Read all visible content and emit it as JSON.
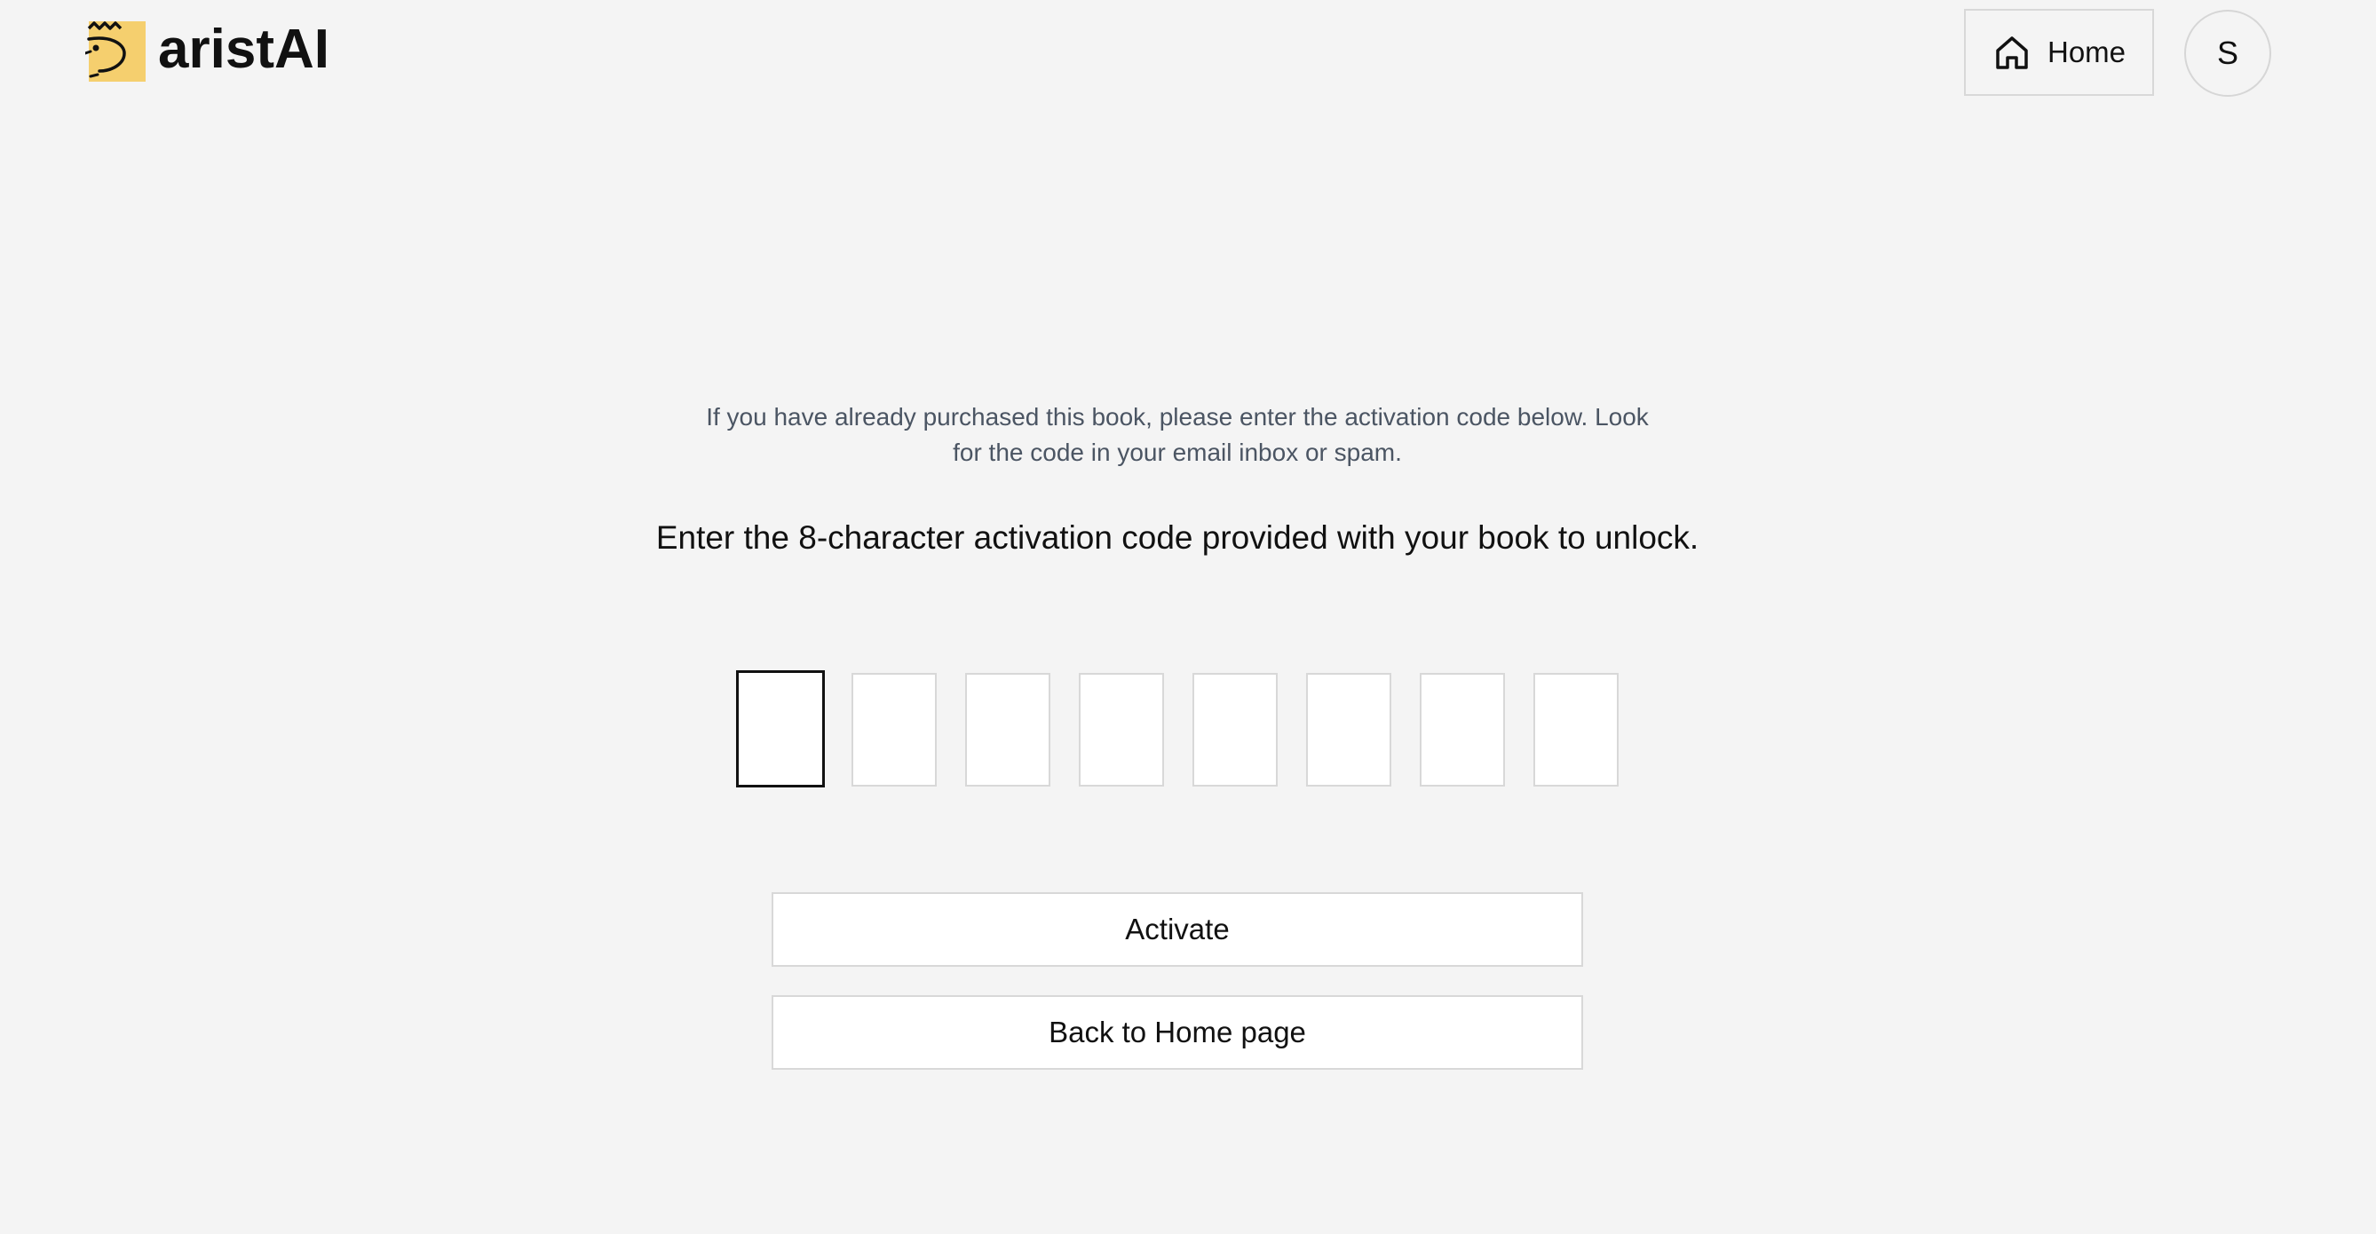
{
  "header": {
    "logo_text": "aristAI",
    "home_button_label": "Home",
    "avatar_initial": "S"
  },
  "main": {
    "info_text": "If you have already purchased this book, please enter the activation code below. Look for the code in your email inbox or spam.",
    "instruction": "Enter the 8-character activation code provided with your book to unlock.",
    "code_length": 8,
    "code_values": [
      "",
      "",
      "",
      "",
      "",
      "",
      "",
      ""
    ],
    "activate_label": "Activate",
    "back_label": "Back to Home page"
  },
  "colors": {
    "background": "#f4f4f4",
    "logo_yellow": "#f5cf6e",
    "text_muted": "#4b5563",
    "border": "#d8d8d8",
    "active_border": "#111111"
  }
}
